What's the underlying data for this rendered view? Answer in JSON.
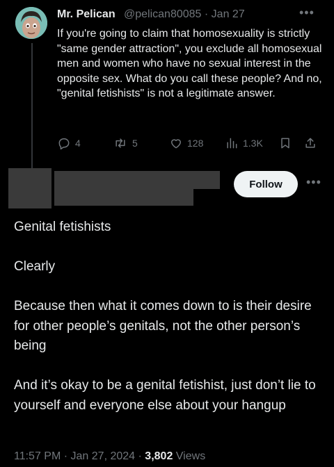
{
  "parent_tweet": {
    "display_name": "Mr. Pelican",
    "handle": "@pelican80085",
    "separator": "·",
    "date": "Jan 27",
    "text": "If you're going to claim that homosexuality is strictly \"same gender attraction\", you exclude all homosexual men and women who have no sexual interest in the opposite sex. What do you call these people? And no, \"genital fetishists\" is not a legitimate answer.",
    "more_icon": "more-horizontal-icon",
    "actions": {
      "replies": "4",
      "retweets": "5",
      "likes": "128",
      "views": "1.3K"
    }
  },
  "reply_tweet": {
    "follow_label": "Follow",
    "paragraphs": [
      "Genital fetishists",
      "Clearly",
      "Because then what it comes down to is their desire for other people’s genitals, not the other person’s being",
      "And it’s okay to be a genital fetishist, just don’t lie to yourself and everyone else about your hangup"
    ],
    "time": "11:57 PM",
    "date": "Jan 27, 2024",
    "views_count": "3,802",
    "views_label": "Views"
  },
  "colors": {
    "background": "#000000",
    "text_primary": "#e7e9ea",
    "text_secondary": "#71767b",
    "redaction": "#3a3a3a",
    "follow_bg": "#eff3f4"
  }
}
